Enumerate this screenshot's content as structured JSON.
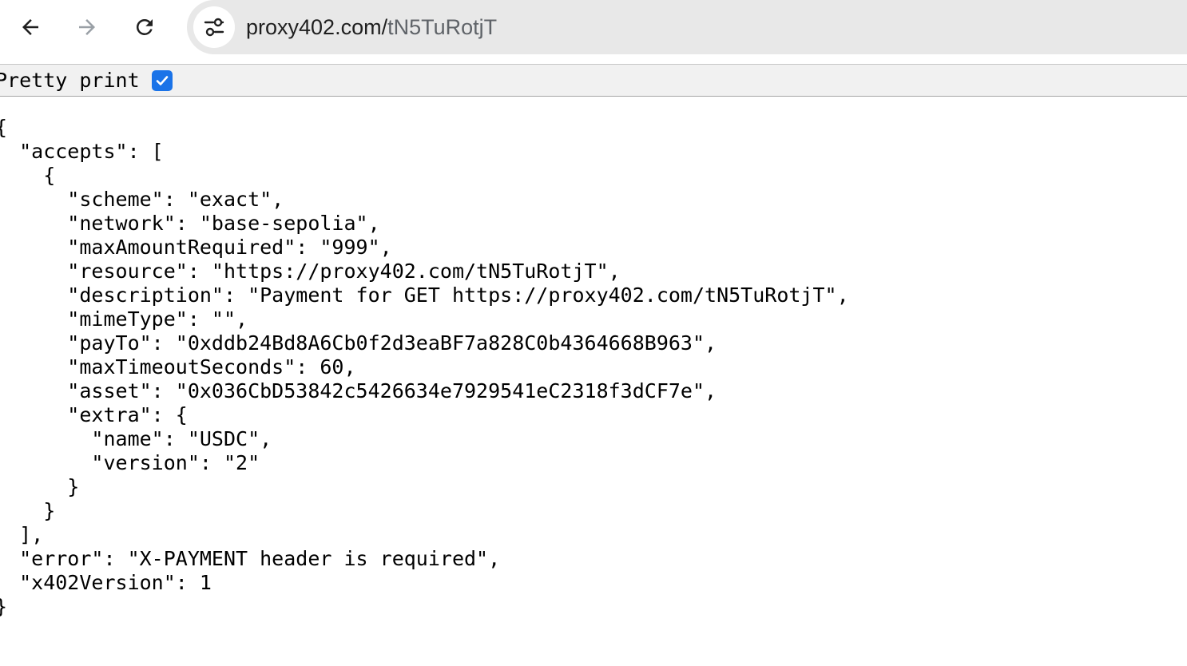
{
  "browser": {
    "url_host": "proxy402.com/",
    "url_path": "tN5TuRotjT",
    "icons": {
      "back": "arrow-left-icon",
      "forward": "arrow-right-icon",
      "reload": "reload-icon",
      "site_info": "tune-icon"
    }
  },
  "viewer": {
    "pretty_print_label": "Pretty print",
    "pretty_print_checked": true,
    "lines": [
      "{",
      "  \"accepts\": [",
      "    {",
      "      \"scheme\": \"exact\",",
      "      \"network\": \"base-sepolia\",",
      "      \"maxAmountRequired\": \"999\",",
      "      \"resource\": \"https://proxy402.com/tN5TuRotjT\",",
      "      \"description\": \"Payment for GET https://proxy402.com/tN5TuRotjT\",",
      "      \"mimeType\": \"\",",
      "      \"payTo\": \"0xddb24Bd8A6Cb0f2d3eaBF7a828C0b4364668B963\",",
      "      \"maxTimeoutSeconds\": 60,",
      "      \"asset\": \"0x036CbD53842c5426634e7929541eC2318f3dCF7e\",",
      "      \"extra\": {",
      "        \"name\": \"USDC\",",
      "        \"version\": \"2\"",
      "      }",
      "    }",
      "  ],",
      "  \"error\": \"X-PAYMENT header is required\",",
      "  \"x402Version\": 1",
      "}"
    ]
  },
  "colors": {
    "omnibox_bg": "#e8e8e8",
    "checkbox_accent": "#1a73e8",
    "pretty_bar_bg": "#f1f1f1"
  }
}
